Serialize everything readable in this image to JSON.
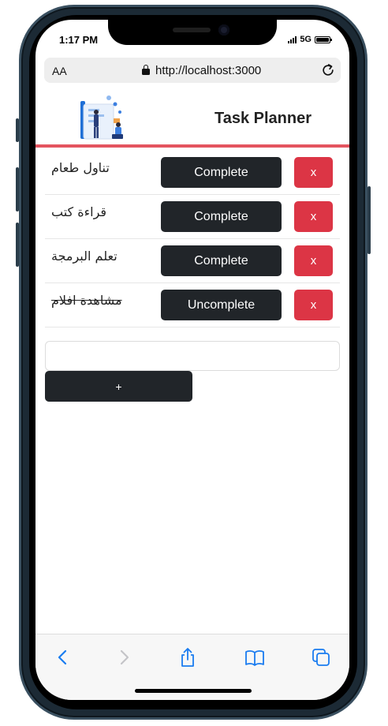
{
  "status_bar": {
    "time": "1:17 PM",
    "network": "5G"
  },
  "browser": {
    "text_size_label": "AA",
    "url": "http://localhost:3000"
  },
  "app": {
    "title": "Task Planner"
  },
  "tasks": [
    {
      "text": "تناول طعام",
      "done": false,
      "toggle_label": "Complete",
      "delete_label": "x"
    },
    {
      "text": "قراءة كتب",
      "done": false,
      "toggle_label": "Complete",
      "delete_label": "x"
    },
    {
      "text": "تعلم البرمجة",
      "done": false,
      "toggle_label": "Complete",
      "delete_label": "x"
    },
    {
      "text": "مشاهدة افلام",
      "done": true,
      "toggle_label": "Uncomplete",
      "delete_label": "x"
    }
  ],
  "new_task": {
    "value": "",
    "placeholder": "",
    "add_label": "+"
  },
  "colors": {
    "accent": "#e4545f",
    "dark_button": "#212529",
    "danger": "#dc3545",
    "ios_blue": "#1a7cf0"
  },
  "toolbar_icons": [
    "back-icon",
    "forward-icon",
    "share-icon",
    "bookmarks-icon",
    "tabs-icon"
  ]
}
